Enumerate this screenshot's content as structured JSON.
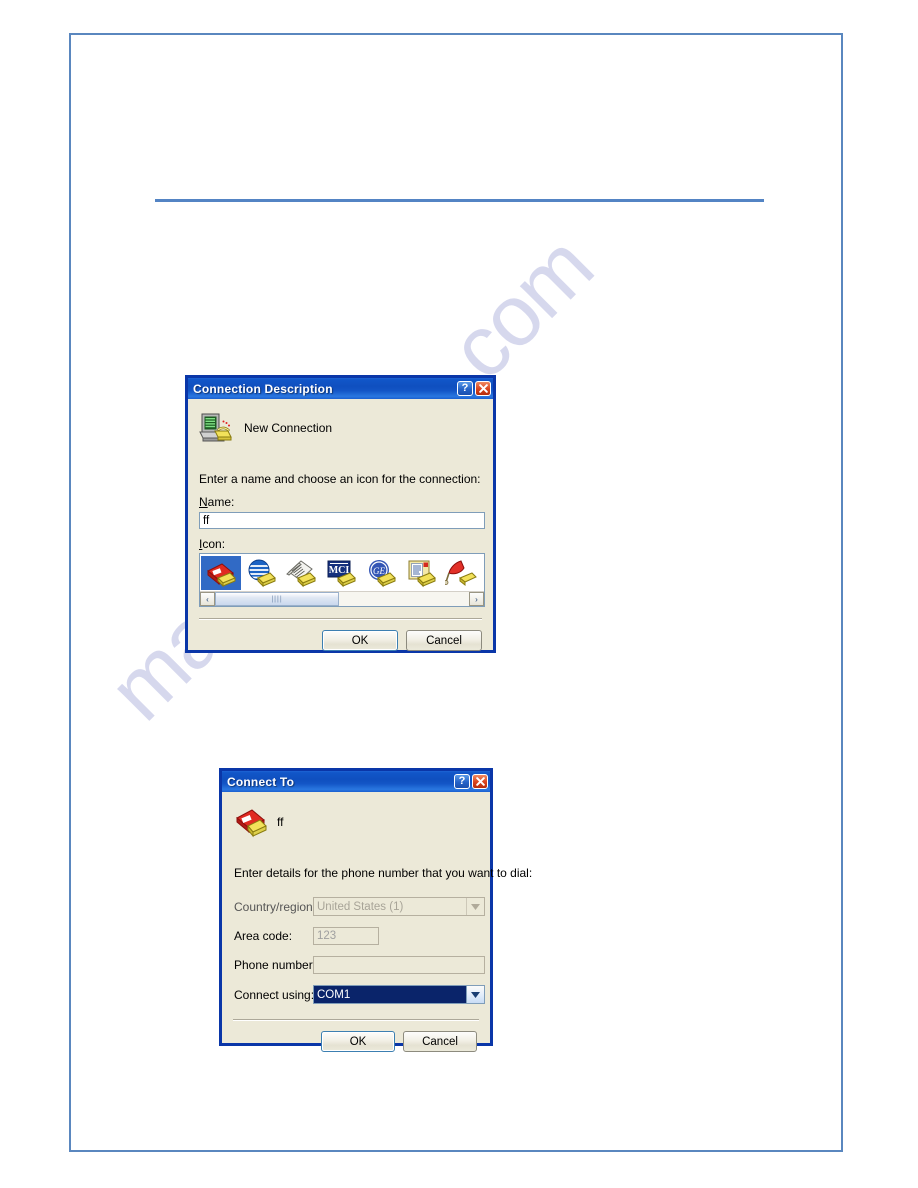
{
  "page": {
    "background_color": "#ffffff",
    "border_color": "#5a87bf",
    "rule_color": "#5384c4",
    "watermark_text": "manualshive.com"
  },
  "dialog_connection_description": {
    "title": "Connection Description",
    "titlebar_help": "?",
    "titlebar_close": "✕",
    "header_icon": "computer-modem-phone-icon",
    "header_label": "New Connection",
    "instruction": "Enter a name and choose an icon for the connection:",
    "name_label": "Name:",
    "name_value": "ff",
    "icon_label": "Icon:",
    "icons": [
      {
        "name": "red-telephone-icon",
        "selected": true
      },
      {
        "name": "att-globe-icon",
        "selected": false
      },
      {
        "name": "newspaper-icon",
        "selected": false
      },
      {
        "name": "mci-logo-icon",
        "selected": false
      },
      {
        "name": "ge-logo-icon",
        "selected": false
      },
      {
        "name": "document-page-icon",
        "selected": false
      },
      {
        "name": "red-kite-icon",
        "selected": false
      }
    ],
    "scroll_left": "‹",
    "scroll_right": "›",
    "ok_label": "OK",
    "cancel_label": "Cancel"
  },
  "dialog_connect_to": {
    "title": "Connect To",
    "titlebar_help": "?",
    "titlebar_close": "✕",
    "header_icon": "red-telephone-icon",
    "header_label": "ff",
    "instruction": "Enter details for the phone number that you want to dial:",
    "fields": [
      {
        "label": "Country/region:",
        "value": "United States (1)",
        "control": "combo",
        "disabled": true,
        "selected": false
      },
      {
        "label": "Area code:",
        "value": "123",
        "control": "textbox",
        "disabled": true,
        "selected": false
      },
      {
        "label": "Phone number:",
        "value": "",
        "control": "textbox",
        "disabled": true,
        "selected": false
      },
      {
        "label": "Connect using:",
        "value": "COM1",
        "control": "combo",
        "disabled": false,
        "selected": true
      }
    ],
    "ok_label": "OK",
    "cancel_label": "Cancel"
  }
}
